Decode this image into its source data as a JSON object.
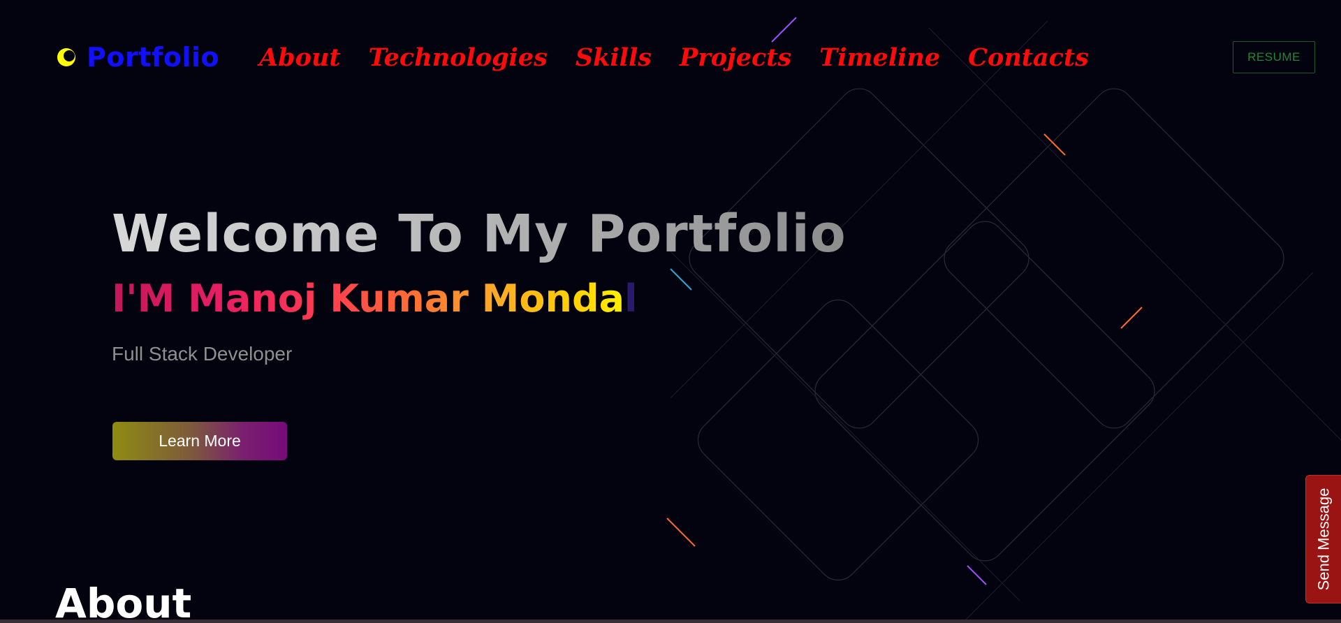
{
  "brand": {
    "name": "Portfolio",
    "icon": "crescent-logo-icon",
    "icon_color": "#ffff00"
  },
  "nav": {
    "items": [
      {
        "label": "About"
      },
      {
        "label": "Technologies"
      },
      {
        "label": "Skills"
      },
      {
        "label": "Projects"
      },
      {
        "label": "Timeline"
      },
      {
        "label": "Contacts"
      }
    ],
    "resume_label": "RESUME"
  },
  "hero": {
    "title": "Welcome To My Portfolio",
    "name_typed": "I'M Manoj Kumar Monda",
    "name_cursor_letter": "l",
    "role": "Full Stack Developer",
    "cta_label": "Learn More"
  },
  "about": {
    "heading": "About"
  },
  "floating": {
    "send_message_label": "Send Message"
  },
  "colors": {
    "background": "#03030f",
    "brand": "#1010ff",
    "nav_links": "#ff0a0a",
    "resume_text": "#1c8a33",
    "send_tab": "#9b1414"
  }
}
